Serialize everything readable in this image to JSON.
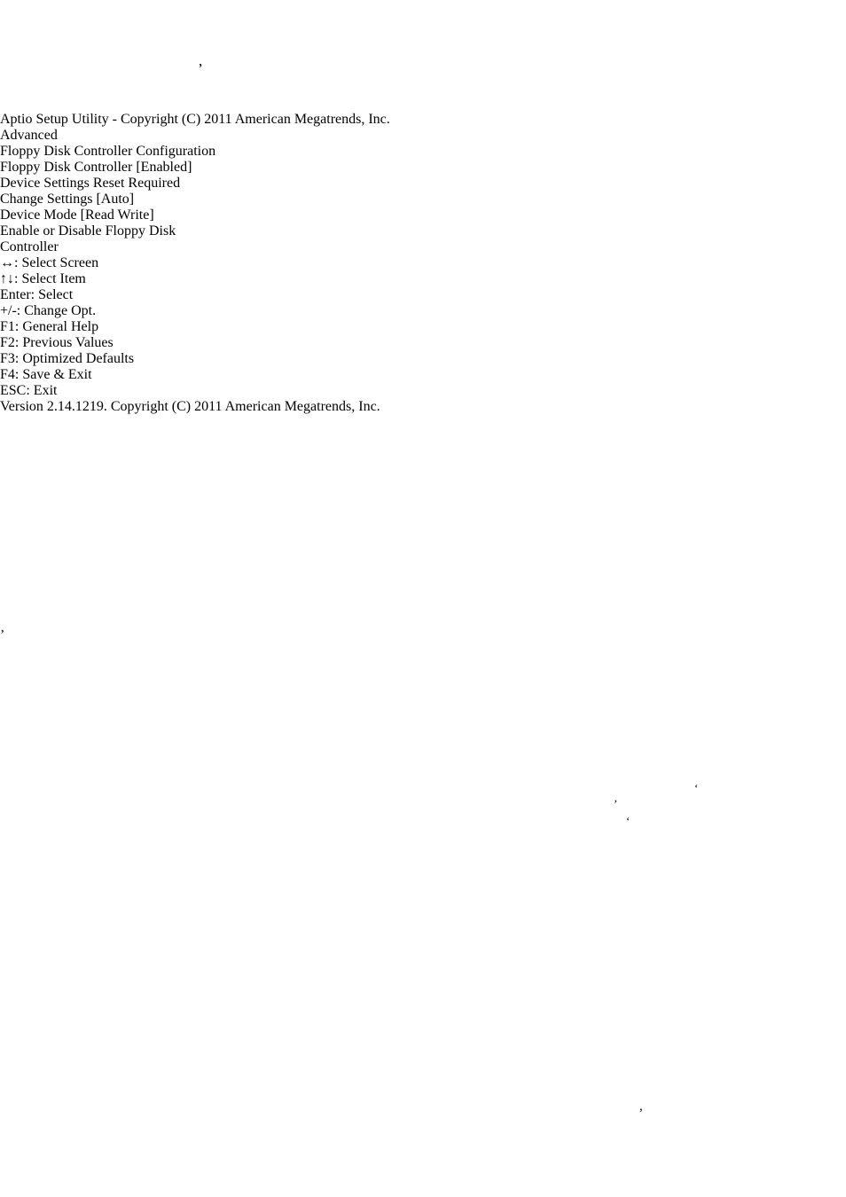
{
  "document": {
    "stray_marks": {
      "top": ",",
      "bottom": ",",
      "cell_a": "‘",
      "cell_b": "’",
      "cell_c": "‘",
      "cell_d": "’"
    }
  },
  "table_top": {
    "columns": [
      "",
      "",
      ""
    ],
    "rows": [
      [
        "",
        "",
        ""
      ],
      [
        "",
        "",
        ""
      ]
    ]
  },
  "table_bottom": {
    "columns": [
      "",
      "",
      ""
    ],
    "rows": [
      [
        "",
        "",
        ""
      ],
      [
        "",
        "",
        ""
      ],
      [
        "",
        "",
        ""
      ]
    ]
  },
  "bios": {
    "title": "Aptio Setup Utility - Copyright (C) 2011 American Megatrends, Inc.",
    "tabs": [
      {
        "label": "Advanced",
        "active": true
      }
    ],
    "section_heading": "Floppy Disk Controller Configuration",
    "items": [
      {
        "label": "Floppy Disk Controller",
        "value": "[Enabled]",
        "style": "white"
      },
      {
        "label": "Device Settings",
        "value": "Reset Required",
        "style": "white"
      },
      {
        "label": "Change Settings",
        "value": "[Auto]",
        "style": "blue"
      },
      {
        "label": "Device Mode",
        "value": "[Read Write]",
        "style": "blue"
      }
    ],
    "help": {
      "line1": "Enable or Disable Floppy Disk",
      "line2": "Controller"
    },
    "keys": [
      "↔: Select Screen",
      "↑↓: Select Item",
      "Enter: Select",
      "+/-: Change Opt.",
      "F1: General Help",
      "F2: Previous Values",
      "F3: Optimized Defaults",
      "F4: Save & Exit",
      "ESC: Exit"
    ],
    "version": "Version 2.14.1219. Copyright (C) 2011 American Megatrends, Inc.",
    "colors": {
      "screen_blue": "#00009c",
      "band_blue": "#000080",
      "panel_gray": "#a0a0a0",
      "border_blue": "#2222c8",
      "text_blue": "#1616b4",
      "text_white": "#e8e8e8",
      "tab_gray": "#a8a8a8"
    }
  }
}
